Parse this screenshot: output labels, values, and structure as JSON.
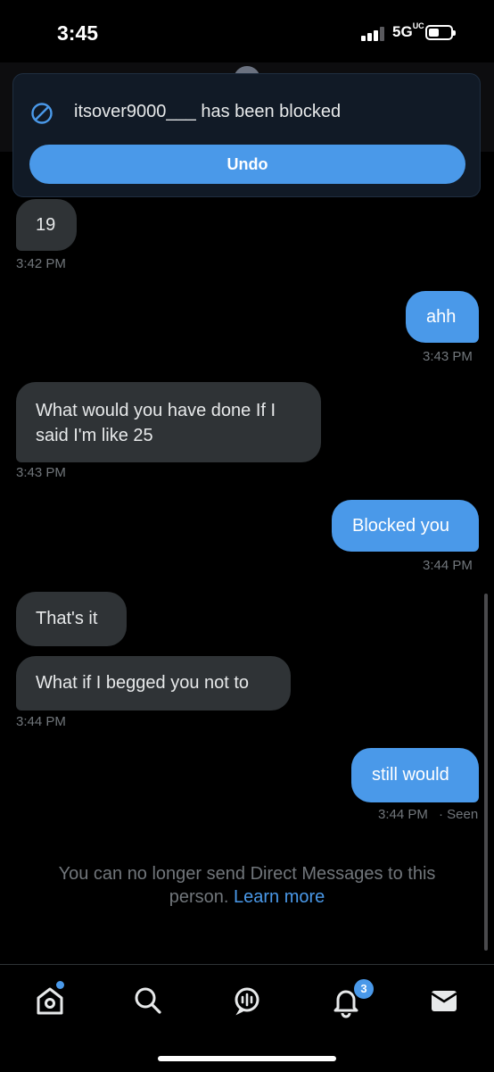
{
  "status_bar": {
    "time": "3:45",
    "network": "5G",
    "network_suffix": "UC"
  },
  "toast": {
    "message": "itsover9000___ has been blocked",
    "undo_label": "Undo",
    "icon": "block-icon"
  },
  "messages": [
    {
      "direction": "in",
      "text": "19",
      "time": "3:42 PM"
    },
    {
      "direction": "out",
      "text": "ahh",
      "time": "3:43 PM"
    },
    {
      "direction": "in",
      "text": "What would you have done If I said I'm like 25",
      "time": "3:43 PM"
    },
    {
      "direction": "out",
      "text": "Blocked you",
      "time": "3:44 PM"
    },
    {
      "direction": "in",
      "text": "That's it"
    },
    {
      "direction": "in",
      "text": "What if I begged you not to",
      "time": "3:44 PM"
    },
    {
      "direction": "out",
      "text": "still would",
      "time": "3:44 PM",
      "seen": "· Seen"
    }
  ],
  "notice": {
    "text": "You can no longer send Direct Messages to this person.",
    "link": "Learn more"
  },
  "bottom_nav": {
    "items": [
      "home-icon",
      "search-icon",
      "spaces-icon",
      "notifications-icon",
      "messages-icon"
    ],
    "notification_count": "3"
  },
  "colors": {
    "accent": "#4a99e9",
    "incoming_bubble": "#2f3336",
    "background": "#000000",
    "muted": "#71767b"
  }
}
